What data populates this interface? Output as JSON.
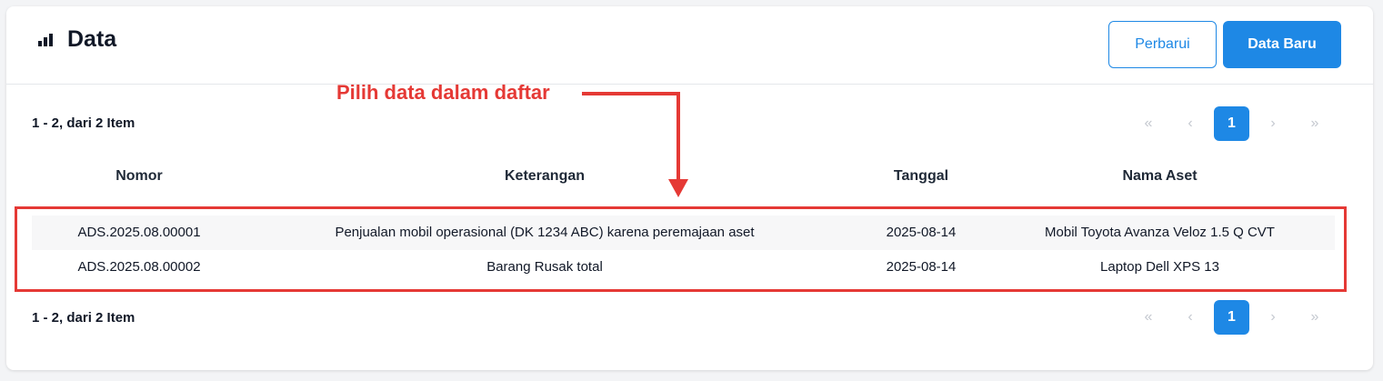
{
  "header": {
    "title": "Data",
    "buttons": {
      "refresh": "Perbarui",
      "new": "Data Baru"
    }
  },
  "annotation": {
    "text": "Pilih data dalam daftar",
    "color": "#e53935"
  },
  "summary": "1 - 2, dari 2 Item",
  "pagination": {
    "first": "«",
    "prev": "‹",
    "current": "1",
    "next": "›",
    "last": "»"
  },
  "table": {
    "columns": [
      "Nomor",
      "Keterangan",
      "Tanggal",
      "Nama Aset"
    ],
    "rows": [
      [
        "ADS.2025.08.00001",
        "Penjualan mobil operasional (DK 1234 ABC) karena peremajaan aset",
        "2025-08-14",
        "Mobil Toyota Avanza Veloz 1.5 Q CVT"
      ],
      [
        "ADS.2025.08.00002",
        "Barang Rusak total",
        "2025-08-14",
        "Laptop Dell XPS 13"
      ]
    ]
  },
  "colors": {
    "accent": "#1e88e5",
    "highlight": "#e53935"
  },
  "icons": {
    "title": "bar-chart-icon"
  }
}
